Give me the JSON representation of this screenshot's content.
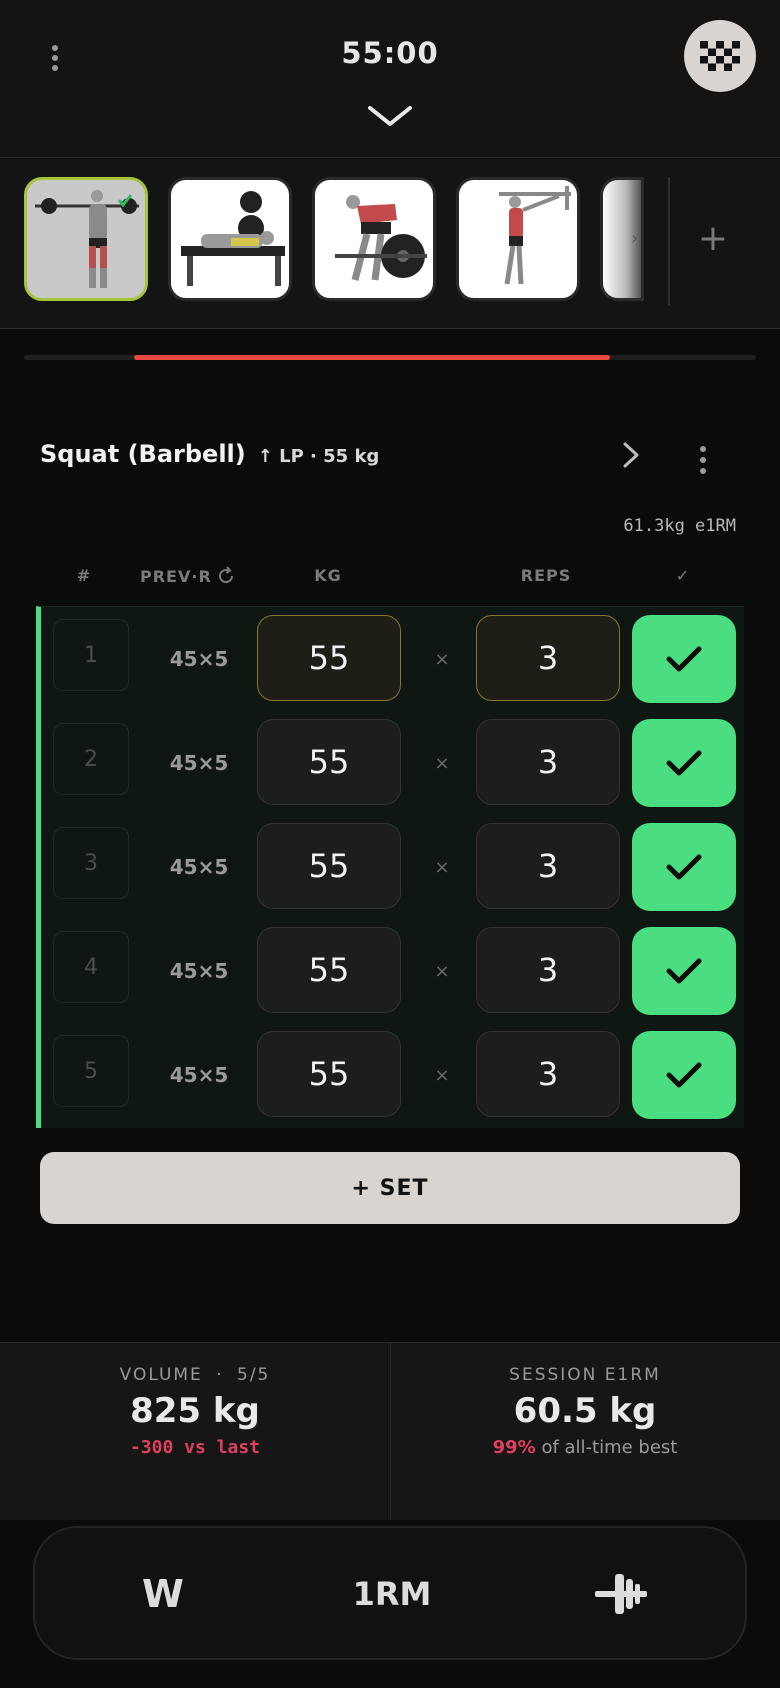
{
  "header": {
    "timer": "55:00"
  },
  "exercise_strip": {
    "thumbnails": [
      "squat-barbell",
      "bench-press",
      "barbell-row",
      "pull-up",
      "next-exercise"
    ],
    "add_label": "+"
  },
  "session_progress": 0.65,
  "exercise": {
    "name": "Squat (Barbell)",
    "progression": "↑ LP · 55 kg",
    "e1rm_note": "61.3kg e1RM"
  },
  "columns": {
    "num": "#",
    "prev": "PREV·R",
    "kg": "KG",
    "reps": "REPS",
    "done": "✓"
  },
  "sets": [
    {
      "num": "1",
      "prev": "45×5",
      "kg": "55",
      "times": "×",
      "reps": "3",
      "done": true
    },
    {
      "num": "2",
      "prev": "45×5",
      "kg": "55",
      "times": "×",
      "reps": "3",
      "done": true
    },
    {
      "num": "3",
      "prev": "45×5",
      "kg": "55",
      "times": "×",
      "reps": "3",
      "done": true
    },
    {
      "num": "4",
      "prev": "45×5",
      "kg": "55",
      "times": "×",
      "reps": "3",
      "done": true
    },
    {
      "num": "5",
      "prev": "45×5",
      "kg": "55",
      "times": "×",
      "reps": "3",
      "done": true
    }
  ],
  "add_set_label": "+ SET",
  "stats": {
    "volume": {
      "label": "VOLUME",
      "sep": "·",
      "count": "5/5",
      "value": "825 kg",
      "delta": "-300 vs last"
    },
    "e1rm": {
      "label": "SESSION E1RM",
      "value": "60.5 kg",
      "pct": "99%",
      "tail": " of all-time best"
    }
  },
  "dock": {
    "warmup_label": "W",
    "onerm_label": "1RM",
    "plates_icon": "plate-calculator-icon"
  },
  "colors": {
    "accent_green": "#4ade80",
    "accent_red": "#e8473f",
    "active_border": "#a6c43c",
    "current_field_border": "#8a7230"
  }
}
